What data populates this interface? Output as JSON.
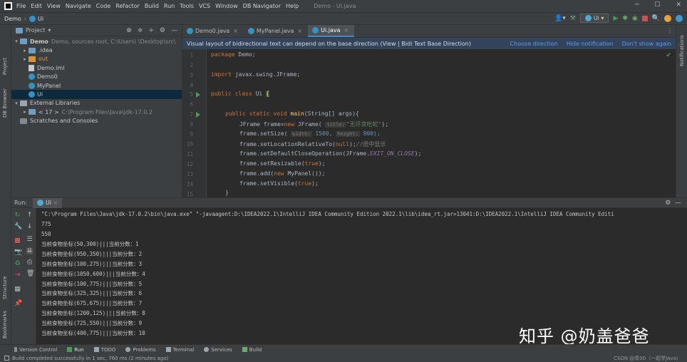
{
  "menubar": {
    "items": [
      "File",
      "Edit",
      "View",
      "Navigate",
      "Code",
      "Refactor",
      "Build",
      "Run",
      "Tools",
      "VCS",
      "Window",
      "DB Navigator",
      "Help"
    ],
    "window_title": "Demo - Ui.java"
  },
  "navbar": {
    "project": "Demo",
    "file": "Ui",
    "run_config": "Ui"
  },
  "left_strip": {
    "project_label": "Project",
    "db_browser_label": "DB Browser",
    "structure_label": "Structure",
    "bookmarks_label": "Bookmarks"
  },
  "right_strip": {
    "notifications_label": "Notifications"
  },
  "project_panel": {
    "title": "Project",
    "tree": [
      {
        "indent": 0,
        "arrow": "▾",
        "icon": "folder",
        "label": "Demo",
        "detail": "Demo, sources root, C:\\Users\\ \\Desktop\\src\\"
      },
      {
        "indent": 1,
        "arrow": "▸",
        "icon": "folder",
        "label": ".idea",
        "detail": ""
      },
      {
        "indent": 1,
        "arrow": "▸",
        "icon": "folder-orange",
        "label": "out",
        "detail": ""
      },
      {
        "indent": 1,
        "arrow": "",
        "icon": "file",
        "label": "Demo.iml",
        "detail": ""
      },
      {
        "indent": 1,
        "arrow": "",
        "icon": "class",
        "label": "Demo0",
        "detail": ""
      },
      {
        "indent": 1,
        "arrow": "",
        "icon": "class",
        "label": "MyPanel",
        "detail": ""
      },
      {
        "indent": 1,
        "arrow": "",
        "icon": "class",
        "label": "Ui",
        "detail": ""
      },
      {
        "indent": 0,
        "arrow": "▾",
        "icon": "library",
        "label": "External Libraries",
        "detail": ""
      },
      {
        "indent": 1,
        "arrow": "▸",
        "icon": "folder",
        "label": "< 17 >",
        "detail": "C:\\Program Files\\Java\\jdk-17.0.2"
      },
      {
        "indent": 0,
        "arrow": "",
        "icon": "scratch",
        "label": "Scratches and Consoles",
        "detail": ""
      }
    ]
  },
  "editor": {
    "tabs": [
      {
        "label": "Demo0.java",
        "active": false
      },
      {
        "label": "MyPanel.java",
        "active": false
      },
      {
        "label": "Ui.java",
        "active": true
      }
    ],
    "banner": {
      "text": "Visual layout of bidirectional text can depend on the base direction (View | Bidi Text Base Direction)",
      "choose": "Choose direction",
      "hide": "Hide notification",
      "dont_show": "Don't show again"
    },
    "line_numbers": [
      "1",
      "2",
      "3",
      "4",
      "5",
      "6",
      "7",
      "8",
      "9",
      "10",
      "11",
      "12",
      "13",
      "14",
      "15"
    ],
    "code": {
      "l1_kw": "package",
      "l1_rest": " Demo;",
      "l3_kw": "import",
      "l3_rest": " javax.swing.JFrame;",
      "l5_kw": "public class",
      "l5_rest": " Ui ",
      "l5_brace": "{",
      "l7_kw": "public static void",
      "l7_fn": "main",
      "l7_rest": "(String[] args){",
      "l8_a": "JFrame frame=",
      "l8_kw": "new",
      "l8_b": " JFrame( ",
      "l8_hint": "title:",
      "l8_str": "\"无尽贪吃蛇\"",
      "l8_c": ");",
      "l9_a": "frame.setSize( ",
      "l9_h1": "width:",
      "l9_v1": " 1500, ",
      "l9_h2": "height:",
      "l9_v2": " 900);",
      "l10_a": "frame.setLocationRelativeTo(",
      "l10_kw": "null",
      "l10_b": ");",
      "l10_cm": "//居中显示",
      "l11_a": "frame.setDefaultCloseOperation(JFrame.",
      "l11_st": "EXIT_ON_CLOSE",
      "l11_b": ");",
      "l12_a": "frame.setResizable(",
      "l12_kw": "true",
      "l12_b": ");",
      "l13_a": "frame.add(",
      "l13_kw": "new",
      "l13_b": " MyPanel());",
      "l14_a": "frame.setVisible(",
      "l14_kw": "true",
      "l14_b": ");",
      "l15": "}"
    }
  },
  "run_panel": {
    "label": "Run:",
    "tab": "Ui",
    "console": [
      "\"C:\\Program Files\\Java\\jdk-17.0.2\\bin\\java.exe\" \"-javaagent:D:\\IDEA2022.1\\IntelliJ IDEA Community Edition 2022.1\\lib\\idea_rt.jar=13041:D:\\IDEA2022.1\\IntelliJ IDEA Community Editi",
      "775",
      "550",
      "当前食物坐标(50,300)|||当前分数：1",
      "当前食物坐标(950,350)|||当前分数：2",
      "当前食物坐标(100,275)|||当前分数：3",
      "当前食物坐标(1050,600)|||当前分数：4",
      "当前食物坐标(100,775)|||当前分数：5",
      "当前食物坐标(325,325)|||当前分数：6",
      "当前食物坐标(675,675)|||当前分数：7",
      "当前食物坐标(1200,125)|||当前分数：8",
      "当前食物坐标(725,550)|||当前分数：9",
      "当前食物坐标(400,775)|||当前分数：10"
    ]
  },
  "watermark": "知乎 @奶盖爸爸",
  "bottom_tabs": [
    "Version Control",
    "Run",
    "TODO",
    "Problems",
    "Terminal",
    "Services",
    "Build"
  ],
  "status": {
    "message": "Build completed successfully in 1 sec, 760 ms (2 minutes ago)",
    "right": "CSDN @青00（一起学Java）"
  },
  "colors": {
    "keyword": "#cc7832",
    "string": "#6a8759",
    "function": "#ffc66d",
    "accent_blue": "#4a88c7",
    "run_green": "#499c54"
  }
}
